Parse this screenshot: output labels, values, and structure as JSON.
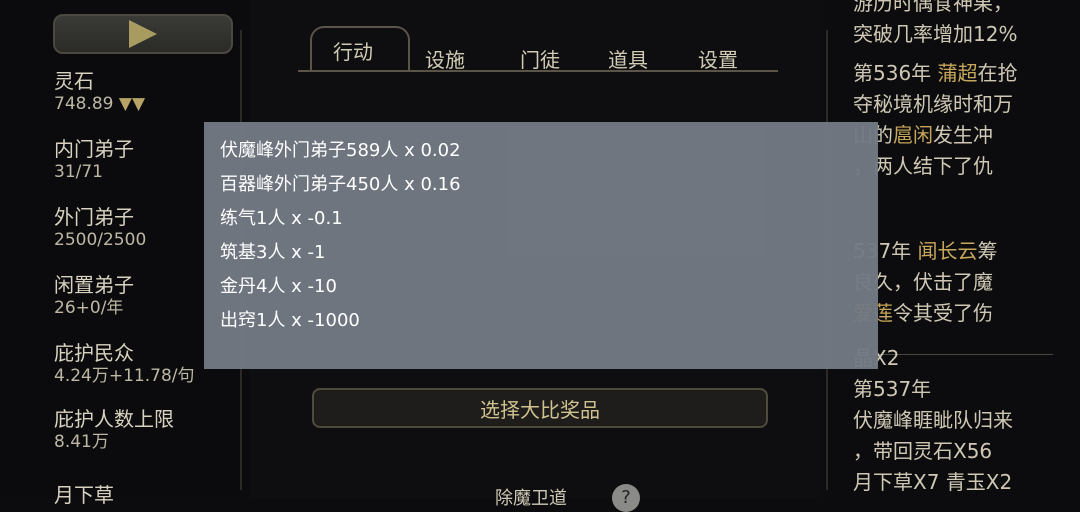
{
  "left": {
    "stats": [
      {
        "label": "灵石",
        "value": "748.89",
        "extra": "▼▼"
      },
      {
        "label": "内门弟子",
        "value": "31/71"
      },
      {
        "label": "外门弟子",
        "value": "2500/2500"
      },
      {
        "label": "闲置弟子",
        "value": "26+0/年"
      },
      {
        "label": "庇护民众",
        "value": "4.24万+11.78/句"
      },
      {
        "label": "庇护人数上限",
        "value": "8.41万"
      }
    ],
    "partial_label": "月下草"
  },
  "tabs": [
    "行动",
    "设施",
    "门徒",
    "道具",
    "设置"
  ],
  "middle": {
    "bottom_button": "选择大比奖品",
    "bottom_text": "除魔卫道",
    "help": "?"
  },
  "log": {
    "lines_top": [
      "游历时偶食神果，",
      "突破几率增加12%"
    ],
    "entry1": {
      "prefix": "第536年 ",
      "name1": "蒲超",
      "l1": "在抢",
      "l2": "夺秘境机缘时和万",
      "l3a": "山的",
      "name2": "扈闲",
      "l3b": "发生冲",
      "l4": "，两人结下了仇"
    },
    "entry2": {
      "prefix": "537年 ",
      "name1": "闻长云",
      "l1": "筹",
      "l2": "良久，伏击了魔",
      "name2": "爱莲",
      "l3": "令其受了伤"
    },
    "entry3": {
      "l0": "晶X2",
      "l1": "第537年",
      "l2": "伏魔峰睚眦队归来",
      "l3": "，带回灵石X56",
      "l4": "月下草X7 青玉X2"
    }
  },
  "modal": {
    "rows": [
      "伏魔峰外门弟子589人 x 0.02",
      "百器峰外门弟子450人 x 0.16",
      "练气1人 x -0.1",
      "筑基3人 x -1",
      "金丹4人 x -10",
      "出窍1人 x -1000"
    ]
  },
  "colors": {
    "highlight": "#c7a85b",
    "modal_bg": "#747a84"
  }
}
